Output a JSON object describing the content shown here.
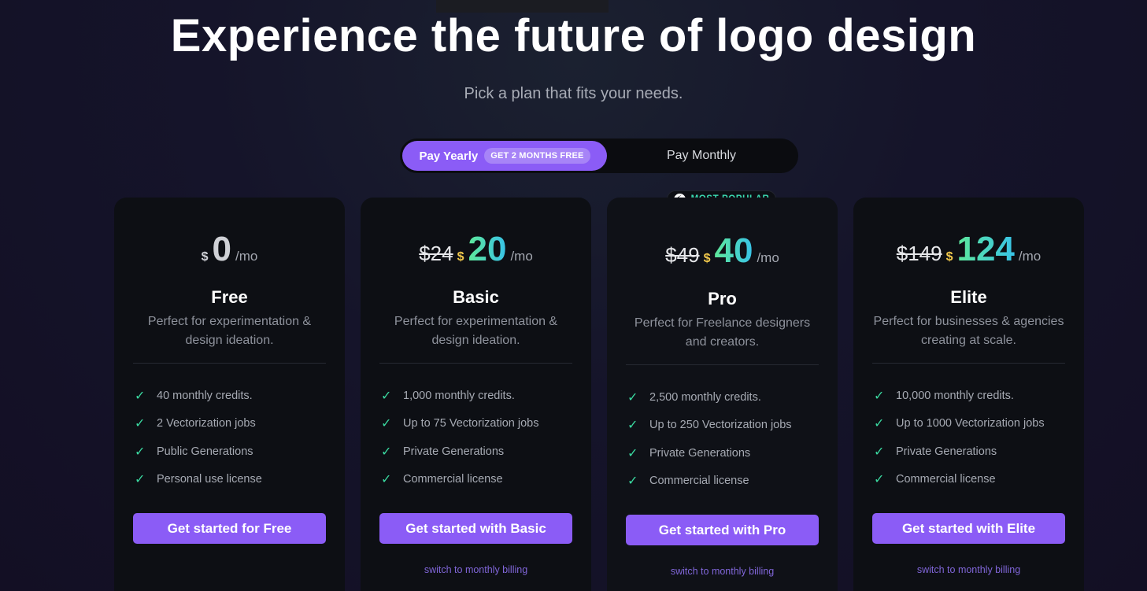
{
  "hero": {
    "title": "Experience the future of logo design",
    "subtitle": "Pick a plan that fits your needs."
  },
  "billing_toggle": {
    "yearly_label": "Pay Yearly",
    "yearly_badge": "GET 2 MONTHS FREE",
    "monthly_label": "Pay Monthly",
    "selected": "yearly"
  },
  "popular_badge": {
    "icon": "bolt-icon",
    "label": "MOST POPULAR"
  },
  "colors": {
    "accent": "#8b5cf6",
    "check": "#3ad9a0",
    "price_gradient_start": "#5ee89a",
    "price_gradient_end": "#38c3e8",
    "currency": "#f2c94c"
  },
  "plans": [
    {
      "name": "Free",
      "old_price": "",
      "currency": "$",
      "price": "0",
      "period": "/mo",
      "description": "Perfect for experimentation & design ideation.",
      "features": [
        "40 monthly credits.",
        "2 Vectorization jobs",
        "Public Generations",
        "Personal use license"
      ],
      "cta": "Get started for Free",
      "switch_link": ""
    },
    {
      "name": "Basic",
      "old_price": "$24",
      "currency": "$",
      "price": "20",
      "period": "/mo",
      "description": "Perfect for experimentation & design ideation.",
      "features": [
        "1,000 monthly credits.",
        "Up to 75 Vectorization jobs",
        "Private Generations",
        "Commercial license"
      ],
      "cta": "Get started with Basic",
      "switch_link": "switch to monthly billing"
    },
    {
      "name": "Pro",
      "old_price": "$49",
      "currency": "$",
      "price": "40",
      "period": "/mo",
      "description": "Perfect for Freelance designers and creators.",
      "features": [
        "2,500 monthly credits.",
        "Up to 250 Vectorization jobs",
        "Private Generations",
        "Commercial license"
      ],
      "cta": "Get started with Pro",
      "switch_link": "switch to monthly billing"
    },
    {
      "name": "Elite",
      "old_price": "$149",
      "currency": "$",
      "price": "124",
      "period": "/mo",
      "description": "Perfect for businesses & agencies creating at scale.",
      "features": [
        "10,000 monthly credits.",
        "Up to 1000 Vectorization jobs",
        "Private Generations",
        "Commercial license"
      ],
      "cta": "Get started with Elite",
      "switch_link": "switch to monthly billing"
    }
  ]
}
